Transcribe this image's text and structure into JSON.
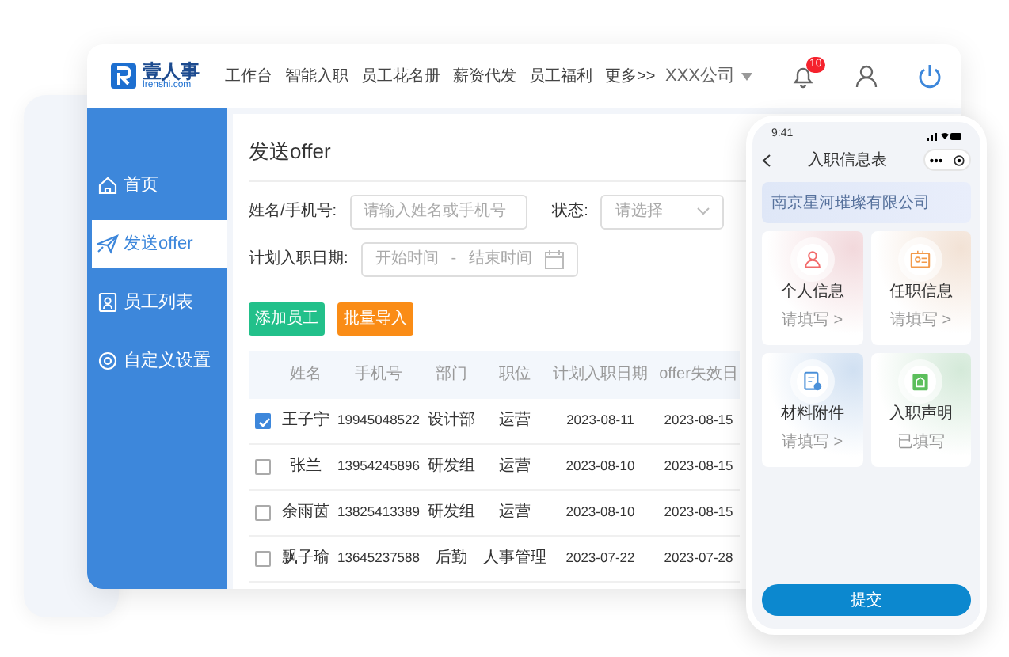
{
  "header": {
    "logo_text": "壹人事",
    "logo_domain": "lrenshi.com",
    "nav": [
      "工作台",
      "智能入职",
      "员工花名册",
      "薪资代发",
      "员工福利",
      "更多>>"
    ],
    "company": "XXX公司",
    "notification_count": "10"
  },
  "sidebar": {
    "items": [
      {
        "label": "首页",
        "selected": false
      },
      {
        "label": "发送offer",
        "selected": true
      },
      {
        "label": "员工列表",
        "selected": false
      },
      {
        "label": "自定义设置",
        "selected": false
      }
    ]
  },
  "page": {
    "title": "发送offer",
    "filters": [
      {
        "label": "姓名/手机号:",
        "kind": "text",
        "placeholder": "请输入姓名或手机号"
      },
      {
        "label": "状态:",
        "kind": "select",
        "placeholder": "请选择"
      },
      {
        "label": "计划入职日期:",
        "kind": "daterange",
        "start_placeholder": "开始时间",
        "separator": "-",
        "end_placeholder": "结束时间"
      }
    ],
    "buttons": [
      {
        "label": "添加员工",
        "color": "#22c08a"
      },
      {
        "label": "批量导入",
        "color": "#fa8c16"
      }
    ],
    "table": {
      "columns": [
        "姓名",
        "手机号",
        "部门",
        "职位",
        "计划入职日期",
        "offer失效日"
      ],
      "rows": [
        {
          "checked": true,
          "cells": [
            "王子宁",
            "19945048522",
            "设计部",
            "运营",
            "2023-08-11",
            "2023-08-15"
          ]
        },
        {
          "checked": false,
          "cells": [
            "张兰",
            "13954245896",
            "研发组",
            "运营",
            "2023-08-10",
            "2023-08-15"
          ]
        },
        {
          "checked": false,
          "cells": [
            "余雨茵",
            "13825413389",
            "研发组",
            "运营",
            "2023-08-10",
            "2023-08-15"
          ]
        },
        {
          "checked": false,
          "cells": [
            "飘子瑜",
            "13645237588",
            "后勤",
            "人事管理",
            "2023-07-22",
            "2023-07-28"
          ]
        }
      ]
    }
  },
  "phone": {
    "time": "9:41",
    "title": "入职信息表",
    "company": "南京星河璀璨有限公司",
    "cards": [
      {
        "title": "个人信息",
        "status": "请填写 >",
        "color": "#f26b6b"
      },
      {
        "title": "任职信息",
        "status": "请填写 >",
        "color": "#f39a4a"
      },
      {
        "title": "材料附件",
        "status": "请填写 >",
        "color": "#4a90d9"
      },
      {
        "title": "入职声明",
        "status": "已填写",
        "color": "#5cbf5c"
      }
    ],
    "submit": "提交"
  }
}
